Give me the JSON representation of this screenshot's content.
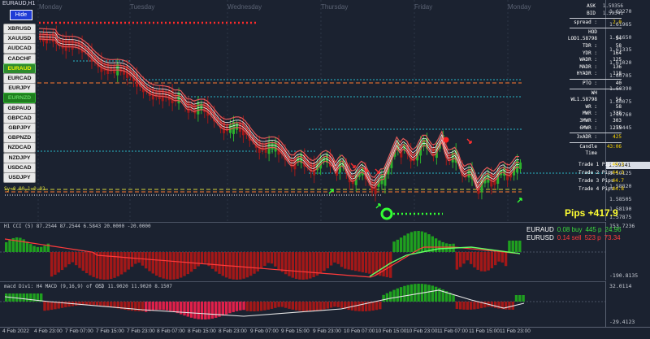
{
  "chart": {
    "title": "EURAUD,H1",
    "hide_label": "Hide",
    "day_labels": [
      "Monday",
      "Tuesday",
      "Wednesday",
      "Thursday",
      "Friday",
      "Monday"
    ],
    "current_price": "1.59341",
    "price_ticks": [
      "1.62270",
      "1.61965",
      "1.61650",
      "1.61335",
      "1.61020",
      "1.60705",
      "1.60390",
      "1.60075",
      "1.59760",
      "1.59445",
      "1.59341",
      "1.59125",
      "1.58820",
      "1.58505",
      "1.58190",
      "1.57875"
    ],
    "pips_total": "Pips +417.9",
    "level_line_label": "Sy=0.00,1=0.02"
  },
  "symbols": [
    {
      "name": "XBRUSD",
      "state": "normal"
    },
    {
      "name": "XAUUSD",
      "state": "normal"
    },
    {
      "name": "AUDCAD",
      "state": "normal"
    },
    {
      "name": "CADCHF",
      "state": "normal"
    },
    {
      "name": "EURAUD",
      "state": "active"
    },
    {
      "name": "EURCAD",
      "state": "normal"
    },
    {
      "name": "EURJPY",
      "state": "normal"
    },
    {
      "name": "EURNZD",
      "state": "highlight"
    },
    {
      "name": "GBPAUD",
      "state": "normal"
    },
    {
      "name": "GBPCAD",
      "state": "normal"
    },
    {
      "name": "GBPJPY",
      "state": "normal"
    },
    {
      "name": "GBPNZD",
      "state": "normal"
    },
    {
      "name": "NZDCAD",
      "state": "normal"
    },
    {
      "name": "NZDJPY",
      "state": "normal"
    },
    {
      "name": "USDCAD",
      "state": "normal"
    },
    {
      "name": "USDJPY",
      "state": "normal"
    }
  ],
  "info_panel": {
    "top": [
      {
        "k": "ASK",
        "v": "1.59356"
      },
      {
        "k": "BID",
        "v": "1.59341"
      }
    ],
    "spread": {
      "k": "spread :",
      "v": "2.0"
    },
    "group1": [
      {
        "k": "HOD",
        "v": ""
      },
      {
        "k": "LOD1.58798 :",
        "v": "54"
      },
      {
        "k": "TDR :",
        "v": "58"
      },
      {
        "k": "YDR :",
        "v": "164"
      },
      {
        "k": "WADR :",
        "v": "125"
      },
      {
        "k": "MADR :",
        "v": "136"
      },
      {
        "k": "HYADR :",
        "v": "118"
      }
    ],
    "pto": {
      "k": "PTO :",
      "v": "40"
    },
    "group2": [
      {
        "k": "WH",
        "v": ""
      },
      {
        "k": "WL1.58798 :",
        "v": "54"
      },
      {
        "k": "WR :",
        "v": "58"
      },
      {
        "k": "MWR :",
        "v": "338"
      },
      {
        "k": "3MWR :",
        "v": "303"
      },
      {
        "k": "6MWR :",
        "v": "275"
      }
    ],
    "adr": {
      "k": "3xADR :",
      "v": "425"
    },
    "candle_time": {
      "k": "Candle Time",
      "v": "43:06"
    }
  },
  "trades": [
    {
      "label": "Trade 1 Pips",
      "value": "44.3"
    },
    {
      "label": "Trade 2 Pips",
      "value": "44.3"
    },
    {
      "label": "Trade 3 Pips",
      "value": "44.7"
    },
    {
      "label": "Trade 4 Pips",
      "value": "44.8"
    }
  ],
  "cci_pane": {
    "caption": "H1 CCI (5) 87.2544 87.2544 6.5843 20.0000 -20.0000",
    "scale_top": "153.7236",
    "scale_bottom": "-190.8135",
    "strength": [
      {
        "pair": "EURAUD",
        "dir": "0.08 buy",
        "count": "445 p",
        "score": "24.96",
        "dir_color": "#3cdc3c"
      },
      {
        "pair": "EURUSD",
        "dir": "0.14 sell",
        "count": "523 p",
        "score": "73.34",
        "dir_color": "#ff3b3b"
      }
    ]
  },
  "macd_pane": {
    "caption": "macd Div1: H4 MACD (9,16,9) of CCI",
    "values": "(5) 11.9020 11.9020 8.1507",
    "scale_top": "32.0114",
    "scale_bottom": "-29.4123"
  },
  "time_axis": [
    "4 Feb 2022",
    "4 Feb 23:00",
    "7 Feb 07:00",
    "7 Feb 15:00",
    "7 Feb 23:00",
    "8 Feb 07:00",
    "8 Feb 15:00",
    "8 Feb 23:00",
    "9 Feb 07:00",
    "9 Feb 15:00",
    "9 Feb 23:00",
    "10 Feb 07:00",
    "10 Feb 15:00",
    "10 Feb 23:00",
    "11 Feb 07:00",
    "11 Feb 15:00",
    "11 Feb 23:00"
  ],
  "colors": {
    "background": "#1b2230",
    "bull": "#2db12d",
    "bear": "#a31818",
    "ma_band": "#e05050",
    "level_cyan": "#2ab8c8",
    "level_orange": "#ff7a30",
    "level_yellow": "#d6d63a",
    "dots_red": "#ff2a2a",
    "dots_green": "#33ff33"
  }
}
